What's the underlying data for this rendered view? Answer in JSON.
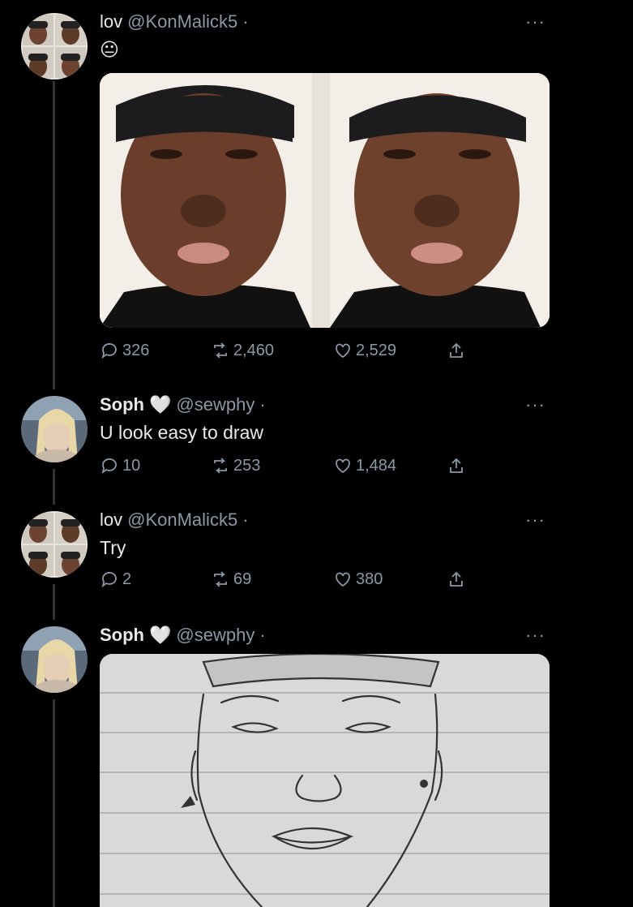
{
  "tweets": [
    {
      "name": "lov",
      "handle": "@KonMalick5",
      "separator": "·",
      "text": "😐",
      "stats": {
        "replies": "326",
        "retweets": "2,460",
        "likes": "2,529"
      }
    },
    {
      "name": "Soph",
      "name_emoji": "🤍",
      "handle": "@sewphy",
      "separator": "·",
      "text": "U look easy to draw",
      "stats": {
        "replies": "10",
        "retweets": "253",
        "likes": "1,484"
      }
    },
    {
      "name": "lov",
      "handle": "@KonMalick5",
      "separator": "·",
      "text": "Try",
      "stats": {
        "replies": "2",
        "retweets": "69",
        "likes": "380"
      }
    },
    {
      "name": "Soph",
      "name_emoji": "🤍",
      "handle": "@sewphy",
      "separator": "·"
    }
  ],
  "more_glyph": "···",
  "icons": [
    "reply-icon",
    "retweet-icon",
    "like-icon",
    "share-icon",
    "more-icon"
  ],
  "colors": {
    "background": "#000000",
    "text": "#e7e9ea",
    "muted": "#8b98a5"
  }
}
